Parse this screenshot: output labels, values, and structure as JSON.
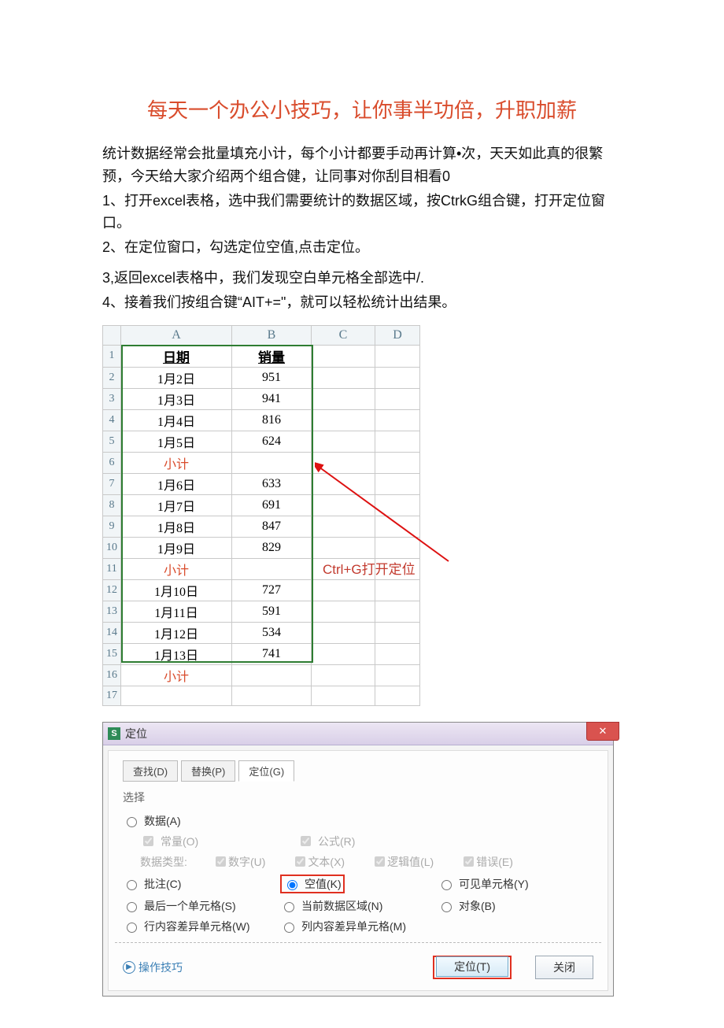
{
  "title": "每天一个办公小技巧，让你事半功倍，升职加薪",
  "paragraphs": {
    "p1": "统计数据经常会批量填充小计，每个小计都要手动再计算•次，天天如此真的很繁预，今天给大家介绍两个组合健，让同事对你刮目相看0",
    "p2": "1、打开excel表格，选中我们需要统计的数据区域，按CtrkG组合键，打开定位窗口。",
    "p3": "2、在定位窗口，勾选定位空值,点击定位。",
    "p4": "3,返回excel表格中，我们发现空白单元格全部选中/.",
    "p5": "4、接着我们按组合键“AIT+=\"，就可以轻松统计出结果。"
  },
  "sheet": {
    "columns": [
      "A",
      "B",
      "C",
      "D"
    ],
    "header": {
      "A": "日期",
      "B": "销量"
    },
    "rows": [
      {
        "n": "1",
        "A": "日期",
        "B": "销量",
        "hdr": true
      },
      {
        "n": "2",
        "A": "1月2日",
        "B": "951"
      },
      {
        "n": "3",
        "A": "1月3日",
        "B": "941"
      },
      {
        "n": "4",
        "A": "1月4日",
        "B": "816"
      },
      {
        "n": "5",
        "A": "1月5日",
        "B": "624"
      },
      {
        "n": "6",
        "A": "小计",
        "B": "",
        "sub": true
      },
      {
        "n": "7",
        "A": "1月6日",
        "B": "633"
      },
      {
        "n": "8",
        "A": "1月7日",
        "B": "691"
      },
      {
        "n": "9",
        "A": "1月8日",
        "B": "847"
      },
      {
        "n": "10",
        "A": "1月9日",
        "B": "829"
      },
      {
        "n": "11",
        "A": "小计",
        "B": "",
        "sub": true
      },
      {
        "n": "12",
        "A": "1月10日",
        "B": "727"
      },
      {
        "n": "13",
        "A": "1月11日",
        "B": "591"
      },
      {
        "n": "14",
        "A": "1月12日",
        "B": "534"
      },
      {
        "n": "15",
        "A": "1月13日",
        "B": "741"
      },
      {
        "n": "16",
        "A": "小计",
        "B": "",
        "sub": true
      },
      {
        "n": "17",
        "A": "",
        "B": ""
      }
    ],
    "annotation": "Ctrl+G打开定位"
  },
  "dialog": {
    "s_icon": "S",
    "title": "定位",
    "tabs": {
      "find": "查找(D)",
      "replace": "替换(P)",
      "goto": "定位(G)"
    },
    "group_label": "选择",
    "opts": {
      "data": "数据(A)",
      "const": "常量(O)",
      "formula": "公式(R)",
      "dtype_label": "数据类型:",
      "num": "数字(U)",
      "text": "文本(X)",
      "logic": "逻辑值(L)",
      "err": "错误(E)",
      "comment": "批注(C)",
      "blank": "空值(K)",
      "visible": "可见单元格(Y)",
      "lastcell": "最后一个单元格(S)",
      "curregion": "当前数据区域(N)",
      "object": "对象(B)",
      "rowdiff": "行内容差异单元格(W)",
      "coldiff": "列内容差异单元格(M)"
    },
    "tip": "操作技巧",
    "close_x": "✕",
    "btn_goto": "定位(T)",
    "btn_close": "关闭"
  }
}
